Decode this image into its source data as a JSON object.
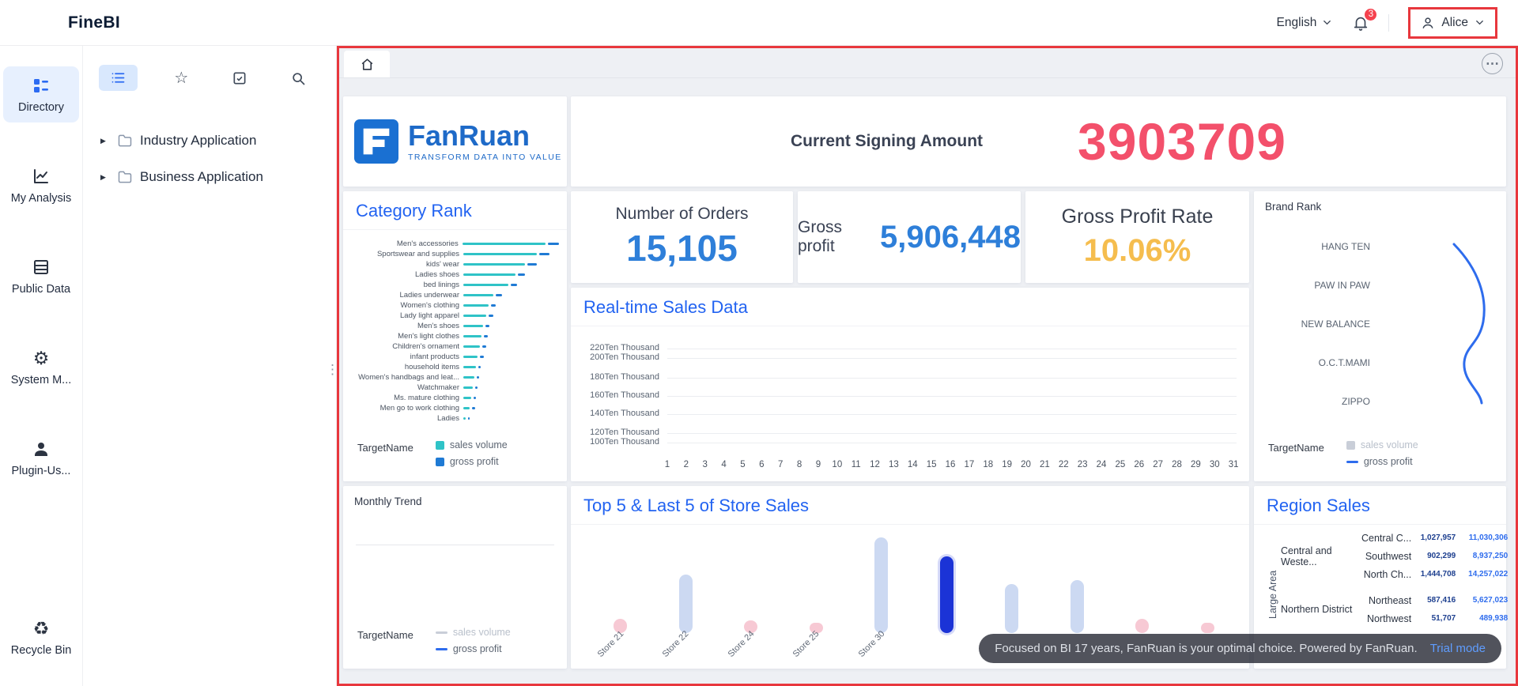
{
  "topbar": {
    "logo": "FineBI",
    "language": "English",
    "notification_count": "3",
    "user_name": "Alice"
  },
  "icons": {
    "topbar": [
      "chevron-down-icon",
      "bell-icon",
      "user-icon"
    ],
    "panel_tabs": [
      "list-icon",
      "star-icon",
      "checklist-icon",
      "search-icon"
    ],
    "sidebar": [
      "grid-list-icon",
      "line-chart-icon",
      "table-icon",
      "gear-icon",
      "user-icon",
      "recycle-icon"
    ],
    "main": [
      "home-icon",
      "more-icon",
      "folder-icon",
      "caret-right-icon"
    ]
  },
  "sidebar": {
    "items": [
      {
        "name": "directory",
        "label": "Directory",
        "active": true
      },
      {
        "name": "my-analysis",
        "label": "My Analysis",
        "active": false
      },
      {
        "name": "public-data",
        "label": "Public Data",
        "active": false
      },
      {
        "name": "system-management",
        "label": "System M...",
        "active": false
      },
      {
        "name": "plugin-usage",
        "label": "Plugin-Us...",
        "active": false
      },
      {
        "name": "recycle-bin",
        "label": "Recycle Bin",
        "active": false
      }
    ]
  },
  "panel": {
    "tree": [
      {
        "label": "Industry Application"
      },
      {
        "label": "Business Application"
      }
    ]
  },
  "dashboard": {
    "logo_card": {
      "brand": "FanRuan",
      "tagline": "TRANSFORM DATA INTO VALUE"
    },
    "signing": {
      "label": "Current Signing Amount",
      "value": "3903709"
    },
    "orders": {
      "label": "Number of Orders",
      "value": "15,105"
    },
    "gross_profit": {
      "label": "Gross profit",
      "value": "5,906,448"
    },
    "gross_profit_rate": {
      "label": "Gross Profit Rate",
      "value": "10.06%"
    },
    "trial_bar": {
      "text": "Focused on BI 17 years, FanRuan is your optimal choice. Powered by FanRuan.",
      "link": "Trial mode"
    }
  },
  "chart_data": [
    {
      "id": "category_rank",
      "type": "bar",
      "orientation": "horizontal",
      "title": "Category Rank",
      "legend_title": "TargetName",
      "series_names": [
        "sales volume",
        "gross profit"
      ],
      "colors": {
        "sales_volume": "#2fc3c7",
        "gross_profit": "#1f7ad4"
      },
      "categories": [
        "Men's accessories",
        "Sportswear and supplies",
        "kids' wear",
        "Ladies shoes",
        "bed linings",
        "Ladies underwear",
        "Women's clothing",
        "Lady light apparel",
        "Men's shoes",
        "Men's light clothes",
        "Children's ornament",
        "infant products",
        "household items",
        "Women's handbags and leat...",
        "Watchmaker",
        "Ms. mature clothing",
        "Men go to work clothing",
        "Ladies"
      ],
      "sales_relative": [
        100,
        88,
        74,
        62,
        54,
        36,
        30,
        27,
        24,
        22,
        20,
        17,
        15,
        13,
        11,
        9,
        8,
        3
      ],
      "profit_relative": [
        9,
        8,
        7,
        6,
        5,
        5,
        4,
        4,
        3,
        3,
        3,
        3,
        2,
        2,
        2,
        2,
        2,
        1
      ]
    },
    {
      "id": "realtime_sales",
      "type": "line",
      "title": "Real-time Sales Data",
      "grid": true,
      "y_ticks": [
        "220Ten Thousand",
        "200Ten Thousand",
        "180Ten Thousand",
        "160Ten Thousand",
        "140Ten Thousand",
        "120Ten Thousand",
        "100Ten Thousand"
      ],
      "x_ticks": [
        "1",
        "2",
        "3",
        "4",
        "5",
        "6",
        "7",
        "8",
        "9",
        "10",
        "11",
        "12",
        "13",
        "14",
        "15",
        "16",
        "17",
        "18",
        "19",
        "20",
        "21",
        "22",
        "23",
        "24",
        "25",
        "26",
        "27",
        "28",
        "29",
        "30",
        "31"
      ]
    },
    {
      "id": "brand_rank",
      "type": "line",
      "title": "Brand Rank",
      "legend_title": "TargetName",
      "series_names": [
        "sales volume",
        "gross profit"
      ],
      "line_color": "#2e6ced",
      "categories": [
        "HANG TEN",
        "PAW IN PAW",
        "NEW BALANCE",
        "O.C.T.MAMI",
        "ZIPPO"
      ]
    },
    {
      "id": "store_sales",
      "type": "bar",
      "title": "Top 5 & Last 5 of Store Sales",
      "categories": [
        "Store 21",
        "Store 22",
        "Store 24",
        "Store 25",
        "Store 30",
        "",
        "",
        "",
        "",
        ""
      ],
      "values_relative": [
        15,
        61,
        13,
        11,
        100,
        80,
        51,
        55,
        15,
        11
      ],
      "bar_styles": [
        "pink",
        "light",
        "pink",
        "pink",
        "light",
        "dark",
        "light",
        "light",
        "pink",
        "pink"
      ],
      "colors": {
        "pink": "#f7c9d4",
        "light": "#ccd9f2",
        "dark": "#1b33d6"
      }
    },
    {
      "id": "monthly_trend",
      "type": "line",
      "title": "Monthly Trend",
      "legend_title": "TargetName",
      "series_names": [
        "sales volume",
        "gross profit"
      ]
    },
    {
      "id": "region_sales",
      "type": "table",
      "title": "Region Sales",
      "axis_label": "Large Area",
      "groups": [
        {
          "label": "Central and Weste...",
          "rows": [
            {
              "name": "Central C...",
              "v1": "1,027,957",
              "v2": "11,030,306"
            },
            {
              "name": "Southwest",
              "v1": "902,299",
              "v2": "8,937,250"
            },
            {
              "name": "North Ch...",
              "v1": "1,444,708",
              "v2": "14,257,022"
            }
          ]
        },
        {
          "label": "Northern District",
          "rows": [
            {
              "name": "Northeast",
              "v1": "587,416",
              "v2": "5,627,023"
            },
            {
              "name": "Northwest",
              "v1": "51,707",
              "v2": "489,938"
            }
          ]
        }
      ]
    }
  ]
}
